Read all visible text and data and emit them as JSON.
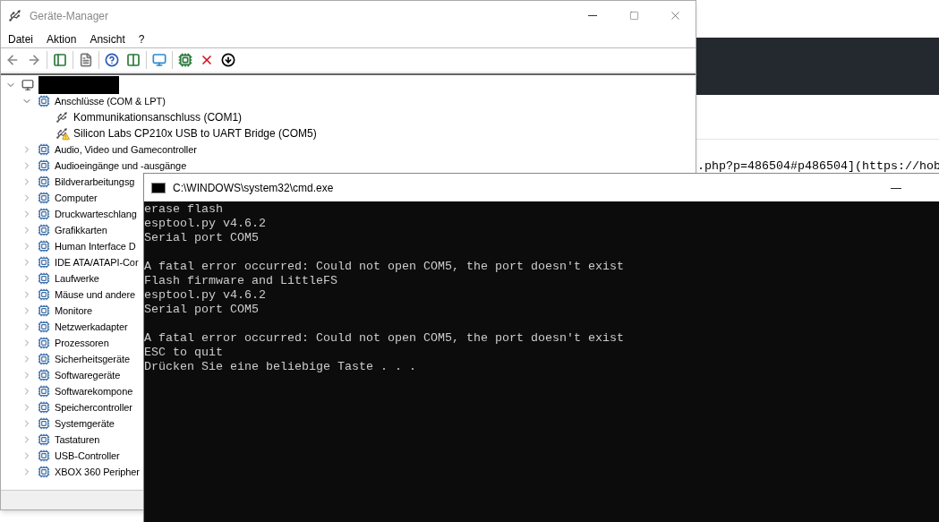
{
  "background_page": {
    "code_line": ".php?p=486504#p486504](https://hob"
  },
  "device_manager": {
    "title": "Geräte-Manager",
    "menu": [
      "Datei",
      "Aktion",
      "Ansicht",
      "?"
    ],
    "tree": {
      "expanded": true,
      "children": [
        {
          "label": "Anschlüsse (COM & LPT)",
          "expanded": true,
          "children": [
            {
              "label": "Kommunikationsanschluss (COM1)",
              "warning": false
            },
            {
              "label": "Silicon Labs CP210x USB to UART Bridge (COM5)",
              "warning": true
            }
          ]
        },
        {
          "label": "Audio, Video und Gamecontroller",
          "expanded": false
        },
        {
          "label": "Audioeingänge und -ausgänge",
          "expanded": false
        },
        {
          "label": "Bildverarbeitungsg",
          "expanded": false
        },
        {
          "label": "Computer",
          "expanded": false
        },
        {
          "label": "Druckwarteschlang",
          "expanded": false
        },
        {
          "label": "Grafikkarten",
          "expanded": false
        },
        {
          "label": "Human Interface D",
          "expanded": false
        },
        {
          "label": "IDE ATA/ATAPI-Cor",
          "expanded": false
        },
        {
          "label": "Laufwerke",
          "expanded": false
        },
        {
          "label": "Mäuse und andere",
          "expanded": false
        },
        {
          "label": "Monitore",
          "expanded": false
        },
        {
          "label": "Netzwerkadapter",
          "expanded": false
        },
        {
          "label": "Prozessoren",
          "expanded": false
        },
        {
          "label": "Sicherheitsgeräte",
          "expanded": false
        },
        {
          "label": "Softwaregeräte",
          "expanded": false
        },
        {
          "label": "Softwarekompone",
          "expanded": false
        },
        {
          "label": "Speichercontroller",
          "expanded": false
        },
        {
          "label": "Systemgeräte",
          "expanded": false
        },
        {
          "label": "Tastaturen",
          "expanded": false
        },
        {
          "label": "USB-Controller",
          "expanded": false
        },
        {
          "label": "XBOX 360 Peripher",
          "expanded": false
        }
      ]
    }
  },
  "console": {
    "title": "C:\\WINDOWS\\system32\\cmd.exe",
    "minimize": "—",
    "blocks": [
      [
        "erase flash",
        "esptool.py v4.6.2",
        "Serial port COM5"
      ],
      [
        "A fatal error occurred: Could not open COM5, the port doesn't exist",
        "Flash firmware and LittleFS",
        "esptool.py v4.6.2",
        "Serial port COM5"
      ],
      [
        "A fatal error occurred: Could not open COM5, the port doesn't exist",
        "ESC to quit",
        "Drücken Sie eine beliebige Taste . . ."
      ]
    ]
  }
}
